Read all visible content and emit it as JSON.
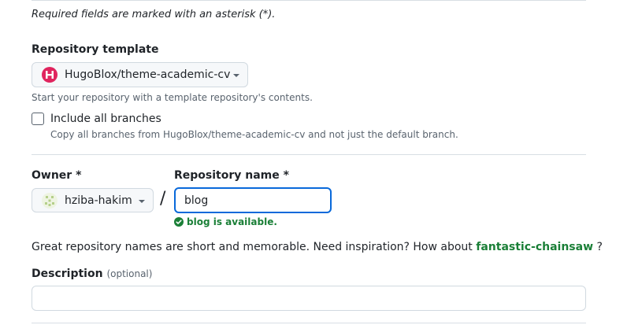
{
  "form": {
    "required_note": "Required fields are marked with an asterisk (*).",
    "template": {
      "label": "Repository template",
      "selected": "HugoBlox/theme-academic-cv",
      "hint": "Start your repository with a template repository's contents.",
      "logo_letter": "H",
      "logo_color": "#e0245e"
    },
    "include_branches": {
      "label": "Include all branches",
      "hint": "Copy all branches from HugoBlox/theme-academic-cv and not just the default branch.",
      "checked": false
    },
    "owner": {
      "label": "Owner *",
      "value": "hziba-hakim",
      "avatar_icon": "identicon-icon"
    },
    "separator": "/",
    "repo_name": {
      "label": "Repository name *",
      "value": "blog",
      "status": "blog is available.",
      "status_color": "#1a7f37"
    },
    "suggestion": {
      "text_before": "Great repository names are short and memorable. Need inspiration? How about",
      "name": "fantastic-chainsaw",
      "text_after": "?"
    },
    "description": {
      "label": "Description",
      "optional": "(optional)",
      "value": ""
    }
  }
}
